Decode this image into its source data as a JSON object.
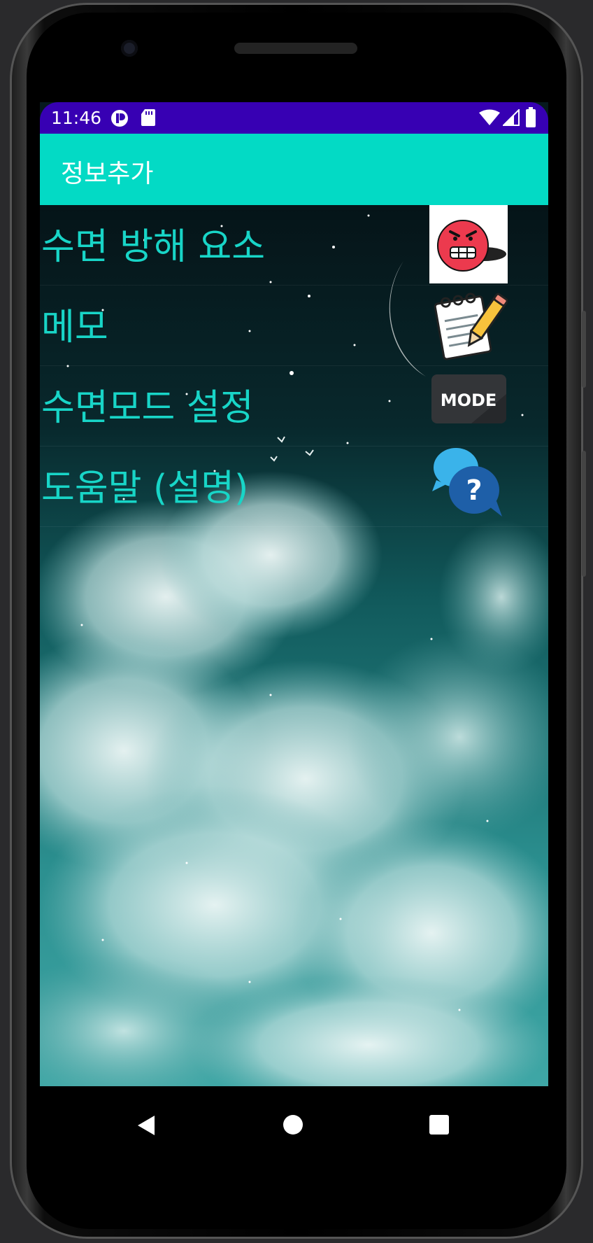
{
  "status_bar": {
    "time": "11:46",
    "background": "#3700b3",
    "icons": [
      "app-notification-icon",
      "sd-card-icon",
      "wifi-icon",
      "cellular-signal-icon",
      "battery-icon"
    ]
  },
  "app_bar": {
    "title": "정보추가",
    "background": "#03dac5"
  },
  "menu": {
    "text_color": "#18d5c7",
    "items": [
      {
        "label": "수면 방해 요소",
        "icon": "angry-face-icon"
      },
      {
        "label": "메모",
        "icon": "notepad-pencil-icon"
      },
      {
        "label": "수면모드 설정",
        "icon": "mode-icon",
        "icon_text": "MODE"
      },
      {
        "label": "도움말 (설명)",
        "icon": "help-chat-icon",
        "icon_text": "?"
      }
    ]
  },
  "nav_bar": {
    "icons": [
      "back-icon",
      "home-icon",
      "recents-icon"
    ]
  }
}
